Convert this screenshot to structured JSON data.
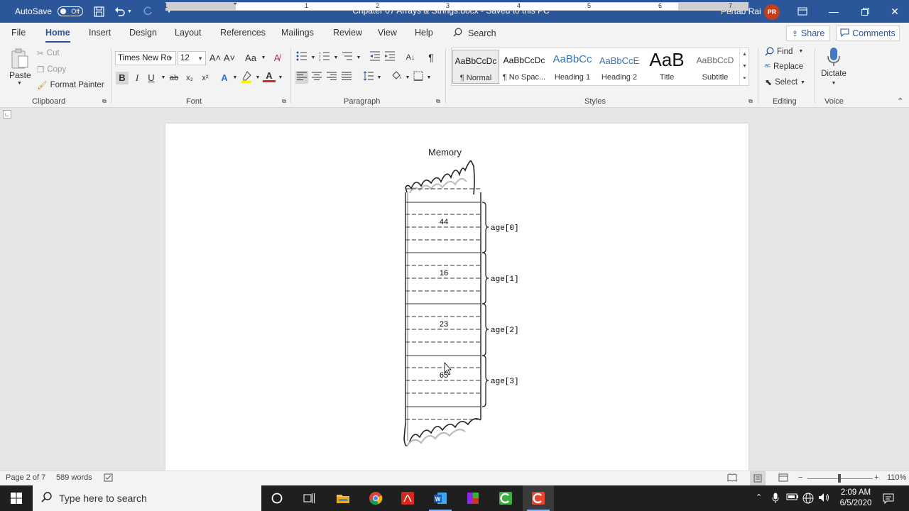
{
  "titlebar": {
    "autosave_label": "AutoSave",
    "autosave_state": "Off",
    "document_title": "Chpater 07 Arrays & Strings.docx  -  Saved to this PC",
    "user_name": "Pertab Rai",
    "user_initials": "PR"
  },
  "tabs": [
    "File",
    "Home",
    "Insert",
    "Design",
    "Layout",
    "References",
    "Mailings",
    "Review",
    "View",
    "Help"
  ],
  "search_label": "Search",
  "share_label": "Share",
  "comments_label": "Comments",
  "ribbon": {
    "clipboard": {
      "paste": "Paste",
      "cut": "Cut",
      "copy": "Copy",
      "format_painter": "Format Painter",
      "group": "Clipboard"
    },
    "font": {
      "name": "Times New Ro",
      "size": "12",
      "group": "Font",
      "bold": "B",
      "italic": "I",
      "underline": "U",
      "strike": "ab",
      "subscript": "x₂",
      "superscript": "x²",
      "change_case": "Aa",
      "grow": "A˄",
      "shrink": "A˅"
    },
    "paragraph": {
      "group": "Paragraph",
      "pilcrow": "¶"
    },
    "styles": {
      "group": "Styles",
      "items": [
        {
          "sample": "AaBbCcDc",
          "name": "¶ Normal"
        },
        {
          "sample": "AaBbCcDc",
          "name": "¶ No Spac..."
        },
        {
          "sample": "AaBbCc",
          "name": "Heading 1"
        },
        {
          "sample": "AaBbCcE",
          "name": "Heading 2"
        },
        {
          "sample": "AaB",
          "name": "Title"
        },
        {
          "sample": "AaBbCcD",
          "name": "Subtitle"
        }
      ]
    },
    "editing": {
      "find": "Find",
      "replace": "Replace",
      "select": "Select",
      "group": "Editing"
    },
    "voice": {
      "dictate": "Dictate",
      "group": "Voice"
    }
  },
  "ruler_numbers": [
    "1",
    "1",
    "2",
    "3",
    "4",
    "5",
    "6",
    "7"
  ],
  "document": {
    "heading": "Memory",
    "cells": [
      {
        "value": "44",
        "label": "age[0]"
      },
      {
        "value": "16",
        "label": "age[1]"
      },
      {
        "value": "23",
        "label": "age[2]"
      },
      {
        "value": "65",
        "label": "age[3]"
      }
    ]
  },
  "statusbar": {
    "page": "Page 2 of 7",
    "words": "589 words",
    "zoom": "110%"
  },
  "taskbar": {
    "search_placeholder": "Type here to search",
    "time": "2:09 AM",
    "date": "6/5/2020"
  },
  "colors": {
    "word_blue": "#2b579a",
    "taskbar": "#1f1f1f"
  }
}
